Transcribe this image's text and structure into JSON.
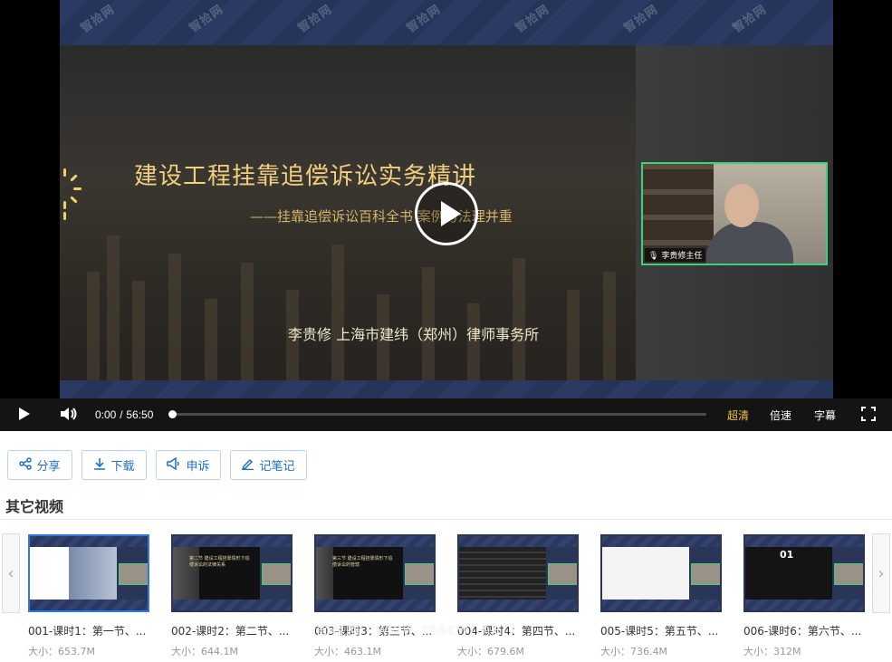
{
  "player": {
    "watermark": "智拾网",
    "slide": {
      "title": "建设工程挂靠追偿诉讼实务精讲",
      "subtitle": "——挂靠追偿诉讼百科全书 案例与法理并重",
      "author": "李贵修  上海市建纬（郑州）律师事务所"
    },
    "speaker_label": "李贵修主任",
    "controls": {
      "current_time": "0:00",
      "separator": "/",
      "duration": "56:50",
      "progress": 0,
      "quality": "超清",
      "speed": "倍速",
      "subtitles": "字幕"
    },
    "colors": {
      "quality_active": "#f5c04a",
      "slide_title": "#f2cf7e"
    }
  },
  "actions": [
    {
      "label": "分享",
      "icon": "share-icon"
    },
    {
      "label": "下载",
      "icon": "download-icon"
    },
    {
      "label": "申诉",
      "icon": "megaphone-icon"
    },
    {
      "label": "记笔记",
      "icon": "pen-icon"
    }
  ],
  "other_videos": {
    "title": "其它视频",
    "items": [
      {
        "title": "001-课时1：第一节、...",
        "size": "大小：653.7M",
        "selected": true
      },
      {
        "title": "002-课时2：第二节、...",
        "size": "大小：644.1M",
        "selected": false
      },
      {
        "title": "003-课时3：第三节、...",
        "size": "大小：463.1M",
        "selected": false
      },
      {
        "title": "004-课时4：第四节、...",
        "size": "大小：679.6M",
        "selected": false
      },
      {
        "title": "005-课时5：第五节、...",
        "size": "大小：736.4M",
        "selected": false
      },
      {
        "title": "006-课时6：第六节、...",
        "size": "大小：312M",
        "selected": false
      }
    ],
    "thumb_texts": [
      "第二节 建设工程挂靠情形下追偿诉讼的法律关系",
      "第三节 建设工程挂靠情形下追偿诉讼的管辖",
      "01"
    ],
    "overlay_watermark": "智拾网（www.zsxcwl.net）"
  }
}
